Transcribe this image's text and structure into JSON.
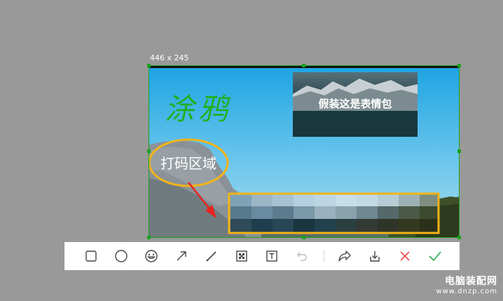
{
  "selection": {
    "size_label": "446 x 245"
  },
  "annotations": {
    "doodle_text": "涂鸦",
    "sticker_text": "假装这是表情包",
    "mosaic_label": "打码区域"
  },
  "toolbar": {
    "tools": [
      {
        "name": "rectangle-tool",
        "icon": "rectangle-icon"
      },
      {
        "name": "ellipse-tool",
        "icon": "circle-icon"
      },
      {
        "name": "emoji-tool",
        "icon": "smiley-icon"
      },
      {
        "name": "arrow-tool",
        "icon": "arrow-icon"
      },
      {
        "name": "pen-tool",
        "icon": "pen-icon"
      },
      {
        "name": "mosaic-tool",
        "icon": "mosaic-icon"
      },
      {
        "name": "text-tool",
        "icon": "text-icon"
      },
      {
        "name": "undo-tool",
        "icon": "undo-icon",
        "disabled": true
      },
      {
        "name": "share-tool",
        "icon": "share-icon"
      },
      {
        "name": "save-tool",
        "icon": "download-icon"
      },
      {
        "name": "cancel-tool",
        "icon": "close-icon"
      },
      {
        "name": "confirm-tool",
        "icon": "check-icon"
      }
    ]
  },
  "colors": {
    "selection_border": "#19a11d",
    "doodle": "#22b022",
    "highlight": "#f2b418",
    "arrow": "#e8231f",
    "cancel": "#e84a4a",
    "confirm": "#2fb14a"
  },
  "watermark": {
    "name": "电脑装配网",
    "url": "www.dnzp.com"
  }
}
